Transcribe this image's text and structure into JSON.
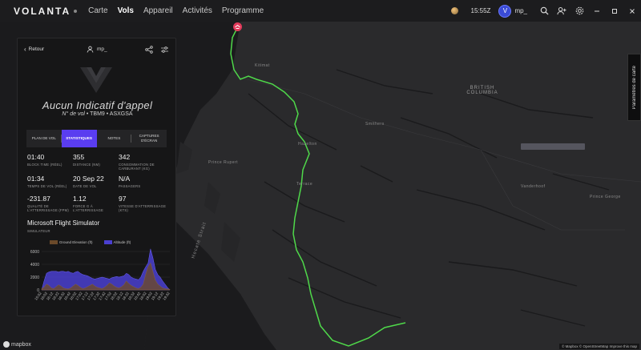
{
  "app": {
    "brand": "VOLANTA",
    "nav": [
      "Carte",
      "Vols",
      "Appareil",
      "Activités",
      "Programme"
    ],
    "active_nav": "Vols",
    "clock": "15:55Z",
    "avatar_letter": "V",
    "username": "mp_",
    "icons": [
      "sun-icon",
      "search-icon",
      "add-user-icon",
      "settings-icon",
      "minimize-icon",
      "maximize-icon",
      "close-icon"
    ],
    "accent_color": "#5a3df0"
  },
  "panel": {
    "back_label": "Retour",
    "username": "mp_",
    "callsign": "Aucun Indicatif d'appel",
    "flight_no_label": "N° de vol",
    "aircraft": "TBM9",
    "registration": "ASXGSA",
    "tabs": [
      "PLAN DE VOL",
      "STATISTIQUES",
      "NOTES",
      "CAPTURES D'ÉCRAN"
    ],
    "active_tab": "STATISTIQUES",
    "stats": [
      {
        "value": "01:40",
        "label": "BLOCK TIME (RÉEL)"
      },
      {
        "value": "355",
        "label": "DISTANCE (NM)"
      },
      {
        "value": "342",
        "label": "CONSOMMATION DE CARBURANT (KG)"
      },
      {
        "value": "01:34",
        "label": "TEMPS DE VOL (RÉEL)"
      },
      {
        "value": "20 Sep 22",
        "label": "DATE DE VOL"
      },
      {
        "value": "N/A",
        "label": "PASSAGERS"
      },
      {
        "value": "-231.87",
        "label": "QUALITÉ DE L'ATTERRISSAGE (FPM)"
      },
      {
        "value": "1.12",
        "label": "FORCE G À L'ATTERRISSAGE"
      },
      {
        "value": "97",
        "label": "VITESSE D'ATTERRISSAGE (KTS)"
      }
    ],
    "simulator": "Microsoft Flight Simulator",
    "simulator_label": "SIMULATEUR"
  },
  "chart_data": {
    "type": "area",
    "series": [
      {
        "name": "Ground Elevation (ft)",
        "color": "#6b4a2a",
        "values": [
          200,
          400,
          900,
          700,
          300,
          200,
          500,
          800,
          600,
          300,
          200,
          150,
          300,
          600,
          900,
          700,
          400,
          200,
          300,
          500,
          700,
          900,
          600,
          400,
          300,
          200,
          400,
          700,
          1100,
          900,
          600,
          400,
          300,
          500,
          800,
          1400,
          1000,
          700,
          500,
          300,
          200,
          400,
          900,
          2400,
          3600,
          4200,
          2800,
          1500,
          900,
          600,
          300,
          200,
          150,
          100
        ]
      },
      {
        "name": "Altitude (ft)",
        "color": "#4a3fd0",
        "values": [
          0,
          1400,
          2600,
          2800,
          2900,
          2900,
          2900,
          2800,
          2900,
          2900,
          2800,
          2900,
          2700,
          2600,
          2800,
          2900,
          2600,
          2400,
          2300,
          2200,
          2000,
          1800,
          1700,
          1800,
          1900,
          2000,
          1900,
          1800,
          1700,
          1900,
          2000,
          2100,
          2000,
          2100,
          2200,
          2600,
          2400,
          2000,
          1800,
          1700,
          1600,
          2000,
          2900,
          3600,
          4200,
          6400,
          5000,
          3200,
          2400,
          2000,
          1400,
          900,
          400,
          0
        ]
      }
    ],
    "ylim": [
      0,
      6500
    ],
    "yticks": [
      "6000",
      "4000",
      "2000",
      "0"
    ],
    "xticks": [
      "15:52",
      "16:02",
      "16:12",
      "16:22",
      "16:32",
      "16:42",
      "16:52",
      "17:02",
      "17:12",
      "17:22",
      "17:32",
      "17:42",
      "17:52",
      "18:02",
      "18:12",
      "18:22",
      "18:32",
      "18:42",
      "18:52",
      "19:02",
      "19:12",
      "19:22",
      "19:32"
    ]
  },
  "map": {
    "region_label": "BRITISH COLUMBIA",
    "settings_label": "Paramètres de carte",
    "places": [
      "Kitimat",
      "Prince Rupert",
      "Smithers",
      "Hazelton",
      "Prince George",
      "Vanderhoof",
      "Prince Rupert",
      "Hecate Strait",
      "Kitimat",
      "Terrace"
    ],
    "route_color": "#4fd94a",
    "origin_marker_color": "#e23a5b",
    "mapbox_label": "mapbox",
    "attribution": "© Mapbox © OpenStreetMap  Improve this map"
  }
}
